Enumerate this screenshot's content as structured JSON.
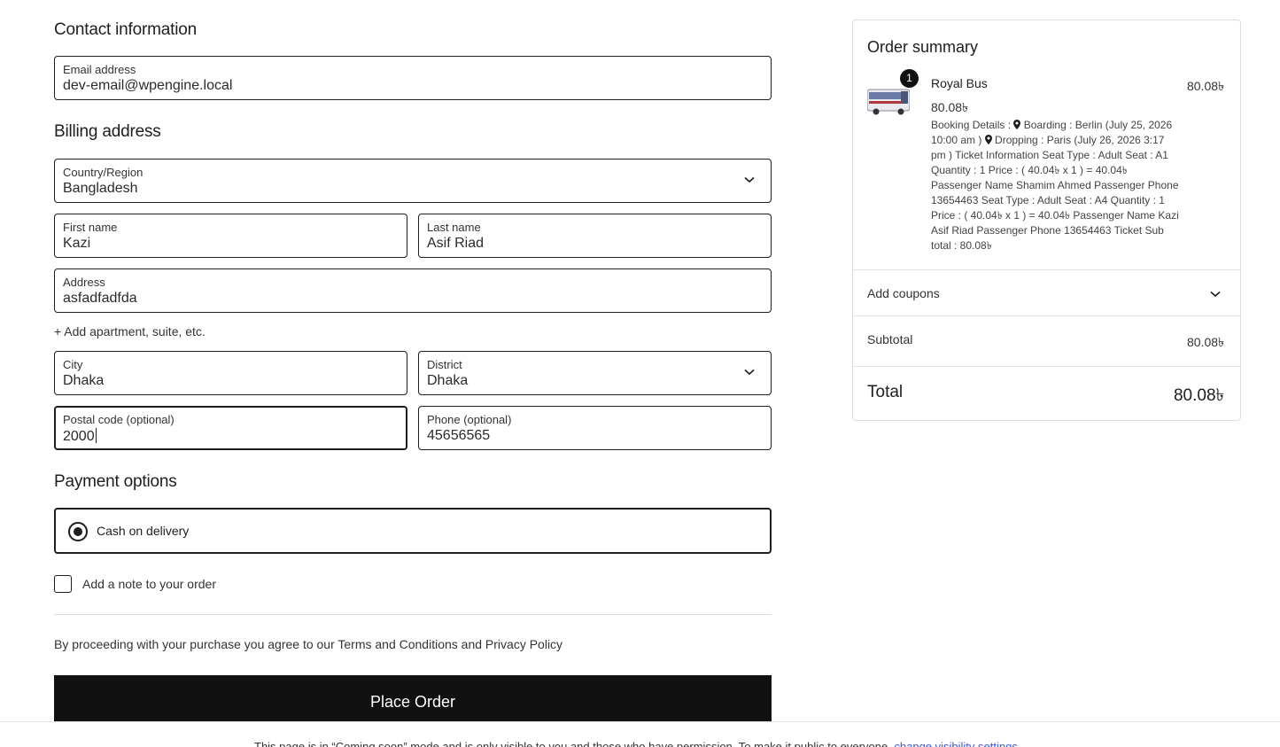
{
  "contact": {
    "heading": "Contact information",
    "email_label": "Email address",
    "email_value": "dev-email@wpengine.local"
  },
  "billing": {
    "heading": "Billing address",
    "country_label": "Country/Region",
    "country_value": "Bangladesh",
    "first_name_label": "First name",
    "first_name_value": "Kazi",
    "last_name_label": "Last name",
    "last_name_value": "Asif Riad",
    "address_label": "Address",
    "address_value": "asfadfadfda",
    "add_apartment": "+ Add apartment, suite, etc.",
    "city_label": "City",
    "city_value": "Dhaka",
    "district_label": "District",
    "district_value": "Dhaka",
    "postal_label": "Postal code (optional)",
    "postal_value": "2000",
    "phone_label": "Phone (optional)",
    "phone_value": "45656565"
  },
  "payment": {
    "heading": "Payment options",
    "option_label": "Cash on delivery",
    "option_selected": true
  },
  "note": {
    "label": "Add a note to your order",
    "checked": false
  },
  "terms_text": "By proceeding with your purchase you agree to our Terms and Conditions and Privacy Policy",
  "place_order_label": "Place Order",
  "coming_soon": {
    "text": "This page is in “Coming soon” mode and is only visible to you and those who have permission. To make it public to everyone, ",
    "link": "change visibility settings"
  },
  "summary": {
    "heading": "Order summary",
    "item": {
      "quantity": "1",
      "name": "Royal Bus",
      "price": "80.08৳",
      "line_total": "80.08৳",
      "desc_1": "Booking Details : ",
      "desc_2": " Boarding : Berlin (July 25, 2026 10:00 am ) ",
      "desc_3": " Dropping : Paris (July 26, 2026 3:17 pm ) Ticket Information Seat Type : Adult Seat : A1 Quantity : 1 Price : ( 40.04৳ x 1 ) = 40.04৳ Passenger Name Shamim Ahmed Passenger Phone 13654463 Seat Type : Adult Seat : A4 Quantity : 1 Price : ( 40.04৳ x 1 ) = 40.04৳ Passenger Name Kazi Asif Riad Passenger Phone 13654463 Ticket Sub total : 80.08৳"
    },
    "coupons_label": "Add coupons",
    "subtotal_label": "Subtotal",
    "subtotal_value": "80.08৳",
    "total_label": "Total",
    "total_value": "80.08৳"
  },
  "colors": {
    "primary": "#111111",
    "border": "#1e1e1e",
    "link": "#3858e9"
  }
}
